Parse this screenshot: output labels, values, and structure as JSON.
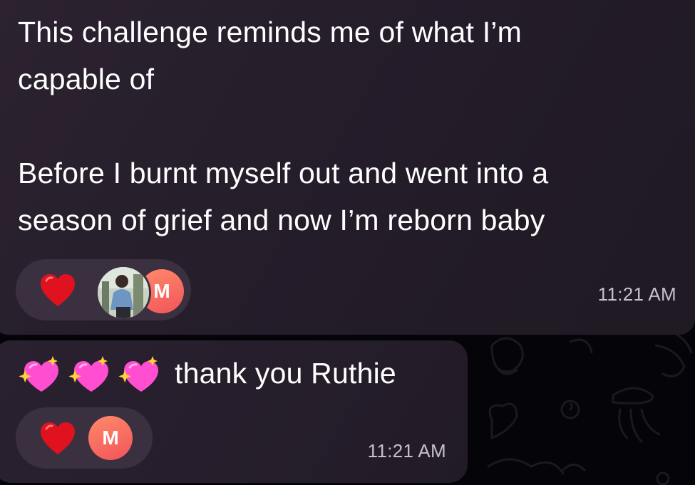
{
  "messages": [
    {
      "text": "This challenge reminds me of what I’m\ncapable of\n\nBefore I burnt myself out and went into a\nseason of grief and now I’m reborn baby",
      "reactions": {
        "emoji": "heart-red-icon",
        "avatars": [
          "photo-avatar",
          "M"
        ]
      },
      "time": "11:21 AM"
    },
    {
      "emojis": [
        "sparkling-heart-icon",
        "sparkling-heart-icon",
        "sparkling-heart-icon"
      ],
      "text": "thank you Ruthie",
      "reactions": {
        "emoji": "heart-red-icon",
        "avatars": [
          "M"
        ]
      },
      "time": "11:21 AM"
    }
  ],
  "colors": {
    "bubble": "#2a2130",
    "reaction_pill": "#3a3040",
    "avatar_gradient_start": "#ff8a6a",
    "avatar_gradient_end": "#f1545a",
    "heart": "#e0121f",
    "sparkle_heart": "#ff4fd0"
  }
}
